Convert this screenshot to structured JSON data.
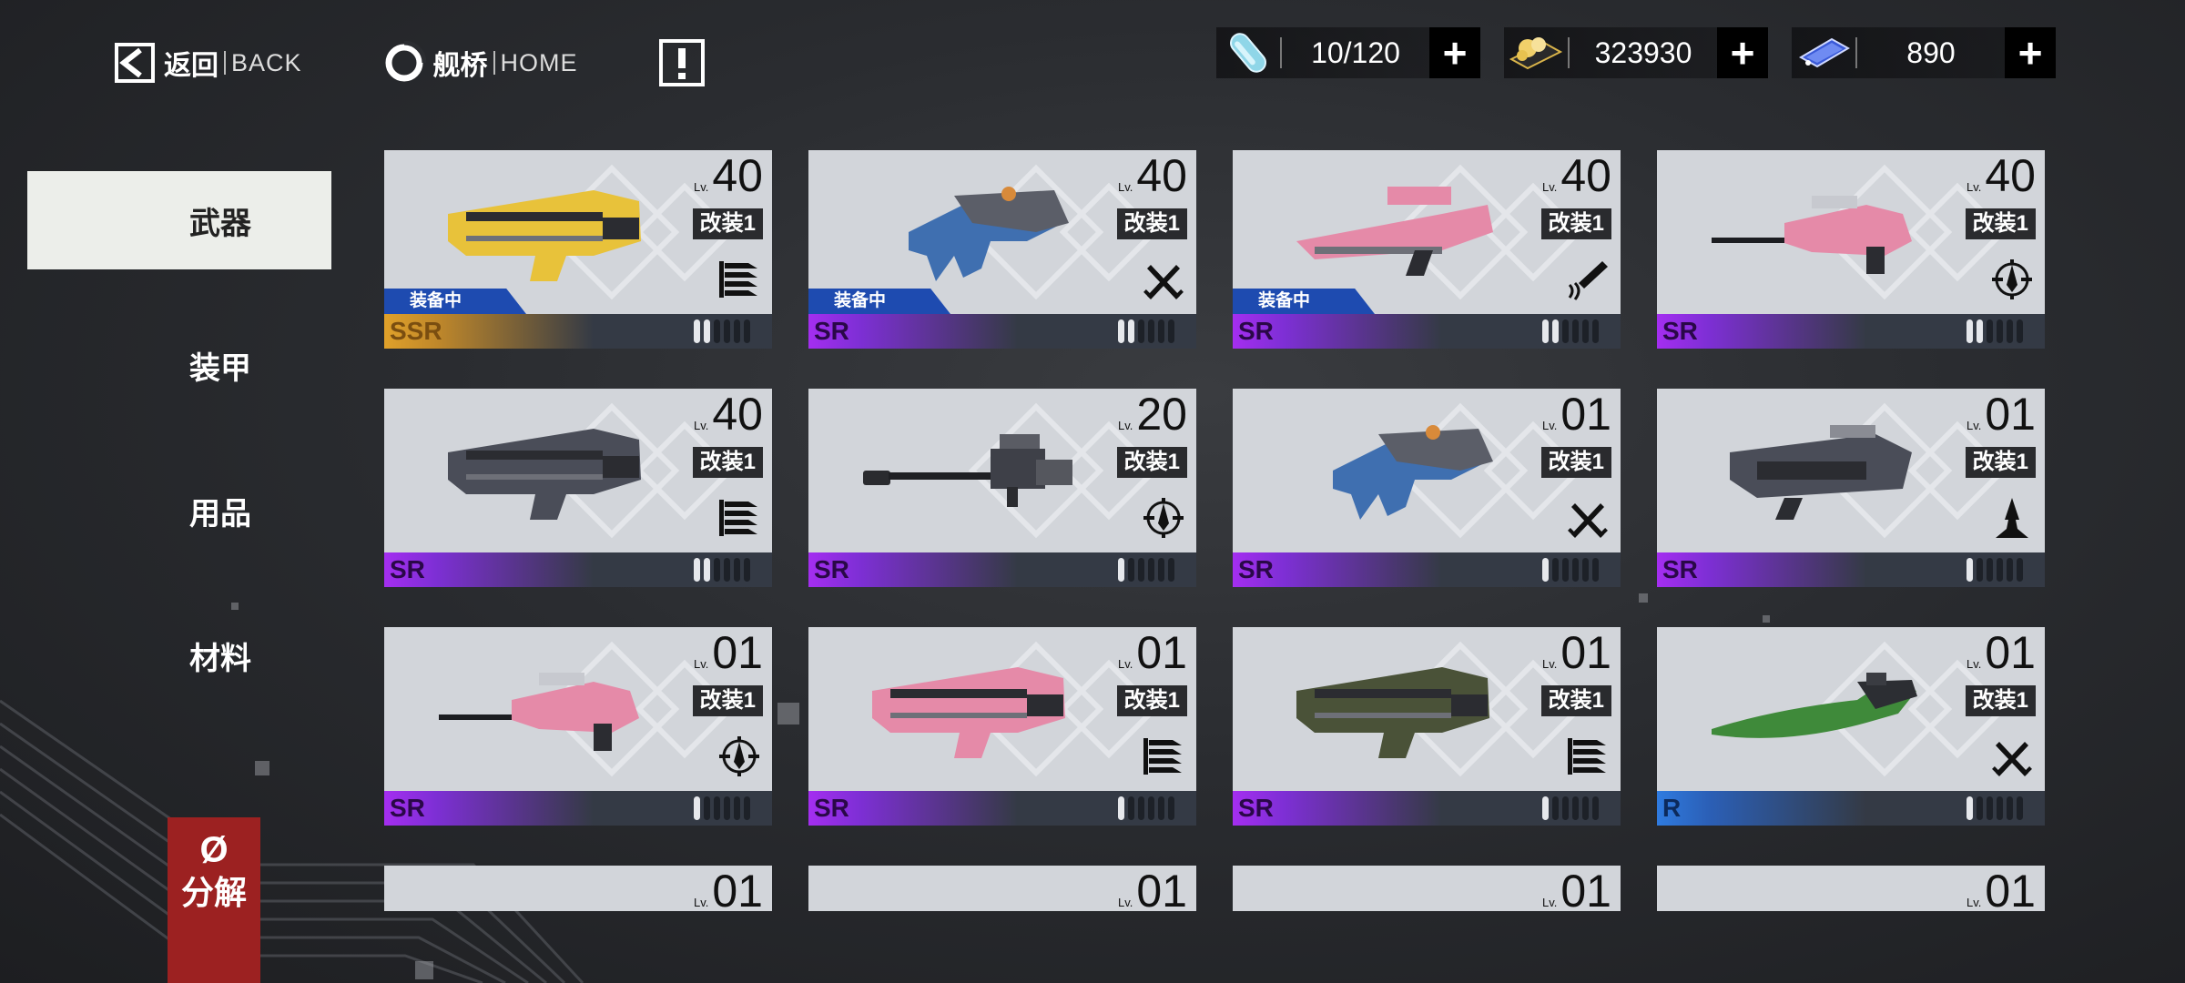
{
  "nav": {
    "back_zh": "返回",
    "back_en": "BACK",
    "home_zh": "舰桥",
    "home_en": "HOME"
  },
  "resources": [
    {
      "icon": "capsule-icon",
      "value": "10/120"
    },
    {
      "icon": "coin-stack-icon",
      "value": "323930"
    },
    {
      "icon": "crystal-card-icon",
      "value": "890"
    }
  ],
  "plus_label": "+",
  "tabs": [
    {
      "label": "武器",
      "active": true
    },
    {
      "label": "装甲",
      "active": false
    },
    {
      "label": "用品",
      "active": false
    },
    {
      "label": "材料",
      "active": false
    }
  ],
  "decompose": {
    "icon": "Ø",
    "label": "分解"
  },
  "lv_label": "Lv.",
  "equipped_label": "装备中",
  "cards": [
    {
      "level": "40",
      "mod": "改装1",
      "rarity": "SSR",
      "equipped": true,
      "type": "pistol",
      "pips": 2,
      "color": "#e8c23a"
    },
    {
      "level": "40",
      "mod": "改装1",
      "rarity": "SR",
      "equipped": true,
      "type": "melee",
      "pips": 2,
      "color": "#3f6fb0"
    },
    {
      "level": "40",
      "mod": "改装1",
      "rarity": "SR",
      "equipped": true,
      "type": "shotgun",
      "pips": 2,
      "color": "#e58aa8"
    },
    {
      "level": "40",
      "mod": "改装1",
      "rarity": "SR",
      "equipped": false,
      "type": "sniper",
      "pips": 2,
      "color": "#e58aa8"
    },
    {
      "level": "40",
      "mod": "改装1",
      "rarity": "SR",
      "equipped": false,
      "type": "pistol",
      "pips": 2,
      "color": "#4a4d58"
    },
    {
      "level": "20",
      "mod": "改装1",
      "rarity": "SR",
      "equipped": false,
      "type": "sniper",
      "pips": 1,
      "color": "#3e4048"
    },
    {
      "level": "01",
      "mod": "改装1",
      "rarity": "SR",
      "equipped": false,
      "type": "melee",
      "pips": 1,
      "color": "#3f6fb0"
    },
    {
      "level": "01",
      "mod": "改装1",
      "rarity": "SR",
      "equipped": false,
      "type": "cannon",
      "pips": 1,
      "color": "#4a4d58"
    },
    {
      "level": "01",
      "mod": "改装1",
      "rarity": "SR",
      "equipped": false,
      "type": "sniper",
      "pips": 1,
      "color": "#e58aa8"
    },
    {
      "level": "01",
      "mod": "改装1",
      "rarity": "SR",
      "equipped": false,
      "type": "pistol",
      "pips": 1,
      "color": "#e58aa8"
    },
    {
      "level": "01",
      "mod": "改装1",
      "rarity": "SR",
      "equipped": false,
      "type": "pistol",
      "pips": 1,
      "color": "#4a5238"
    },
    {
      "level": "01",
      "mod": "改装1",
      "rarity": "R",
      "equipped": false,
      "type": "melee",
      "pips": 1,
      "color": "#3f8a3a"
    },
    {
      "level": "01"
    },
    {
      "level": "01"
    },
    {
      "level": "01"
    },
    {
      "level": "01"
    }
  ]
}
